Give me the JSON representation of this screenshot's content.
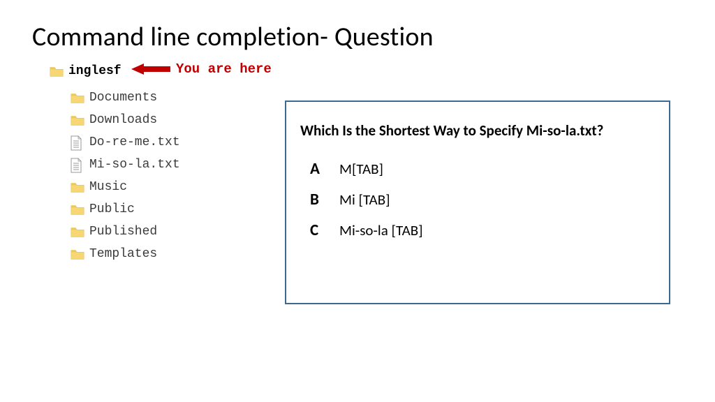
{
  "title": "Command line completion- Question",
  "tree": {
    "root": "inglesf",
    "children": [
      {
        "name": "Documents",
        "type": "folder"
      },
      {
        "name": "Downloads",
        "type": "folder"
      },
      {
        "name": "Do-re-me.txt",
        "type": "file"
      },
      {
        "name": "Mi-so-la.txt",
        "type": "file"
      },
      {
        "name": "Music",
        "type": "folder"
      },
      {
        "name": "Public",
        "type": "folder"
      },
      {
        "name": "Published",
        "type": "folder"
      },
      {
        "name": "Templates",
        "type": "folder"
      }
    ]
  },
  "arrow_label": "You are here",
  "question": {
    "text": "Which Is the Shortest Way to Specify Mi-so-la.txt?",
    "options": [
      {
        "letter": "A",
        "text": "M[TAB]"
      },
      {
        "letter": "B",
        "text": "Mi [TAB]"
      },
      {
        "letter": "C",
        "text": "Mi-so-la [TAB]"
      }
    ]
  },
  "colors": {
    "box_border": "#3a6a92",
    "arrow": "#c00000",
    "folder": "#f7d774",
    "folder_shadow": "#e0b94a"
  }
}
